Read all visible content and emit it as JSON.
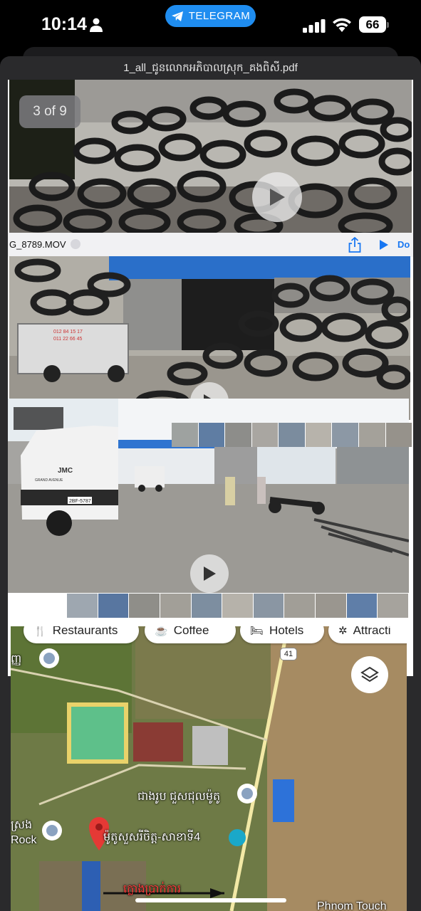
{
  "status_bar": {
    "time": "10:14",
    "app_pill": "TELEGRAM",
    "battery": "66",
    "icons": [
      "person-icon",
      "telegram-icon",
      "signal-icon",
      "wifi-icon",
      "battery-icon"
    ]
  },
  "viewer": {
    "title": "1_all_ជូនលោកអភិបាលស្រុក_គងពិសី.pdf",
    "page_indicator": "3 of 9",
    "video": {
      "filename": "G_8789.MOV",
      "action_partial": "Do"
    },
    "truck_texts": {
      "brand": "JMC",
      "model": "GRAND AVENUE",
      "plate": "2BF-5787",
      "phone1": "012 84 15 17",
      "phone2": "011 22 66 45"
    }
  },
  "map": {
    "chips": [
      "Restaurants",
      "Coffee",
      "Hotels",
      "Attracti"
    ],
    "route_number": "41",
    "labels": {
      "top_left": "ញ្ញ",
      "rock_partial": "ស្រង",
      "rock": "Rock",
      "place1": "ជាងរូប ជួសជុលម៉ូតូ",
      "place2": "ម៉ូតូសួសរីចិត្ត-សាខាទី4",
      "red_label": "ក្លោងប្រាក់ការ",
      "phnom_touch": "Phnom Touch"
    },
    "colors": {
      "pin": "#e53935",
      "route_line": "#f3e9a6",
      "blue_roof": "#2d72d9"
    }
  }
}
